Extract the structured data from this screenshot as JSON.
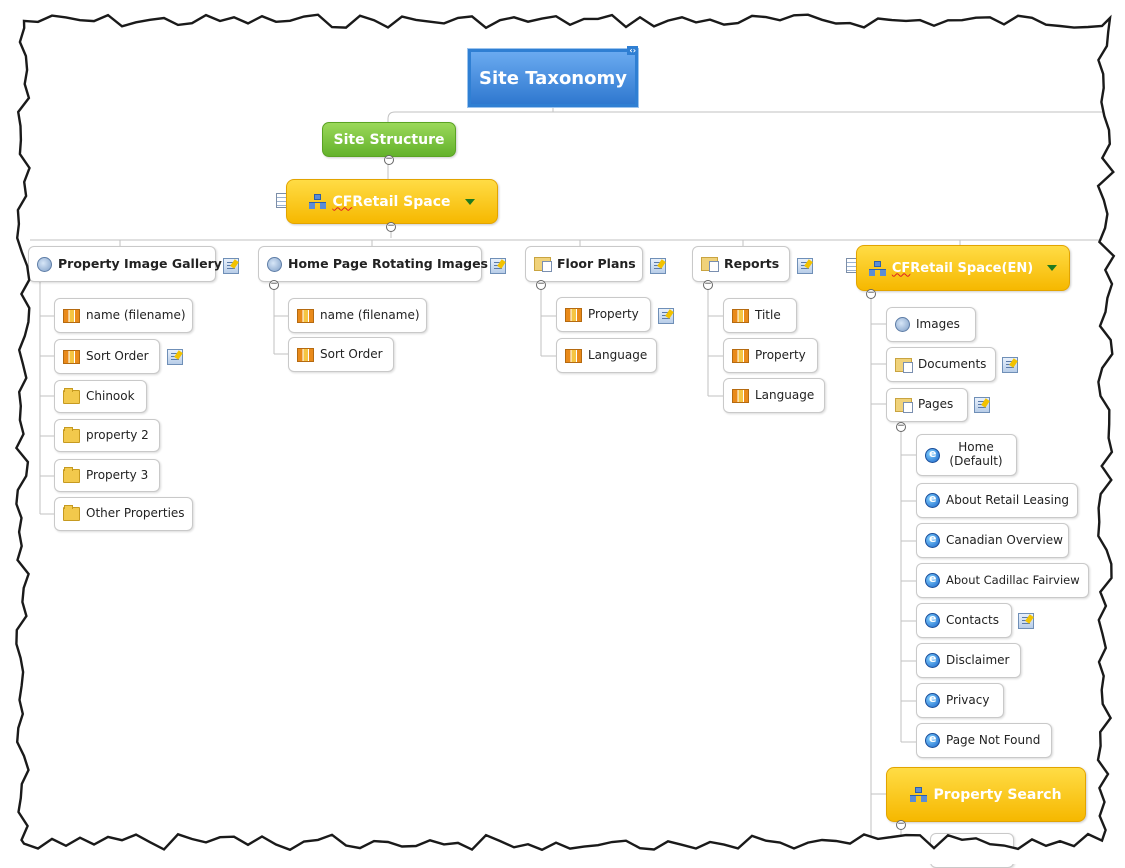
{
  "root": {
    "label": "Site Taxonomy",
    "arrows": "‹›"
  },
  "site_structure": {
    "label": "Site Structure"
  },
  "cf_retail": {
    "label_prefix": "CF",
    "label_rest": " Retail Space"
  },
  "cf_retail_en": {
    "label_prefix": "CF",
    "label_rest": " Retail Space(EN)"
  },
  "property_search": {
    "label": "Property Search"
  },
  "collapse_symbol": "−",
  "branches": {
    "property_image_gallery": {
      "label": "Property Image Gallery",
      "children": [
        "name (filename)",
        "Sort Order",
        "Chinook",
        "property 2",
        "Property 3",
        "Other Properties"
      ]
    },
    "home_page_rotating": {
      "label": "Home Page Rotating Images",
      "children": [
        "name (filename)",
        "Sort Order"
      ]
    },
    "floor_plans": {
      "label": "Floor Plans",
      "children": [
        "Property",
        "Language"
      ]
    },
    "reports": {
      "label": "Reports",
      "children": [
        "Title",
        "Property",
        "Language"
      ]
    },
    "cf_en_children": [
      "Images",
      "Documents",
      "Pages"
    ],
    "pages": [
      "Home (Default)",
      "About Retail Leasing",
      "Canadian Overview",
      "About Cadillac Fairview",
      "Contacts",
      "Disclaimer",
      "Privacy",
      "Page Not Found"
    ]
  },
  "colors": {
    "root": "#2f78cf",
    "green": "#63b22b",
    "yellow": "#f6b800",
    "line": "#bdbdbd"
  }
}
